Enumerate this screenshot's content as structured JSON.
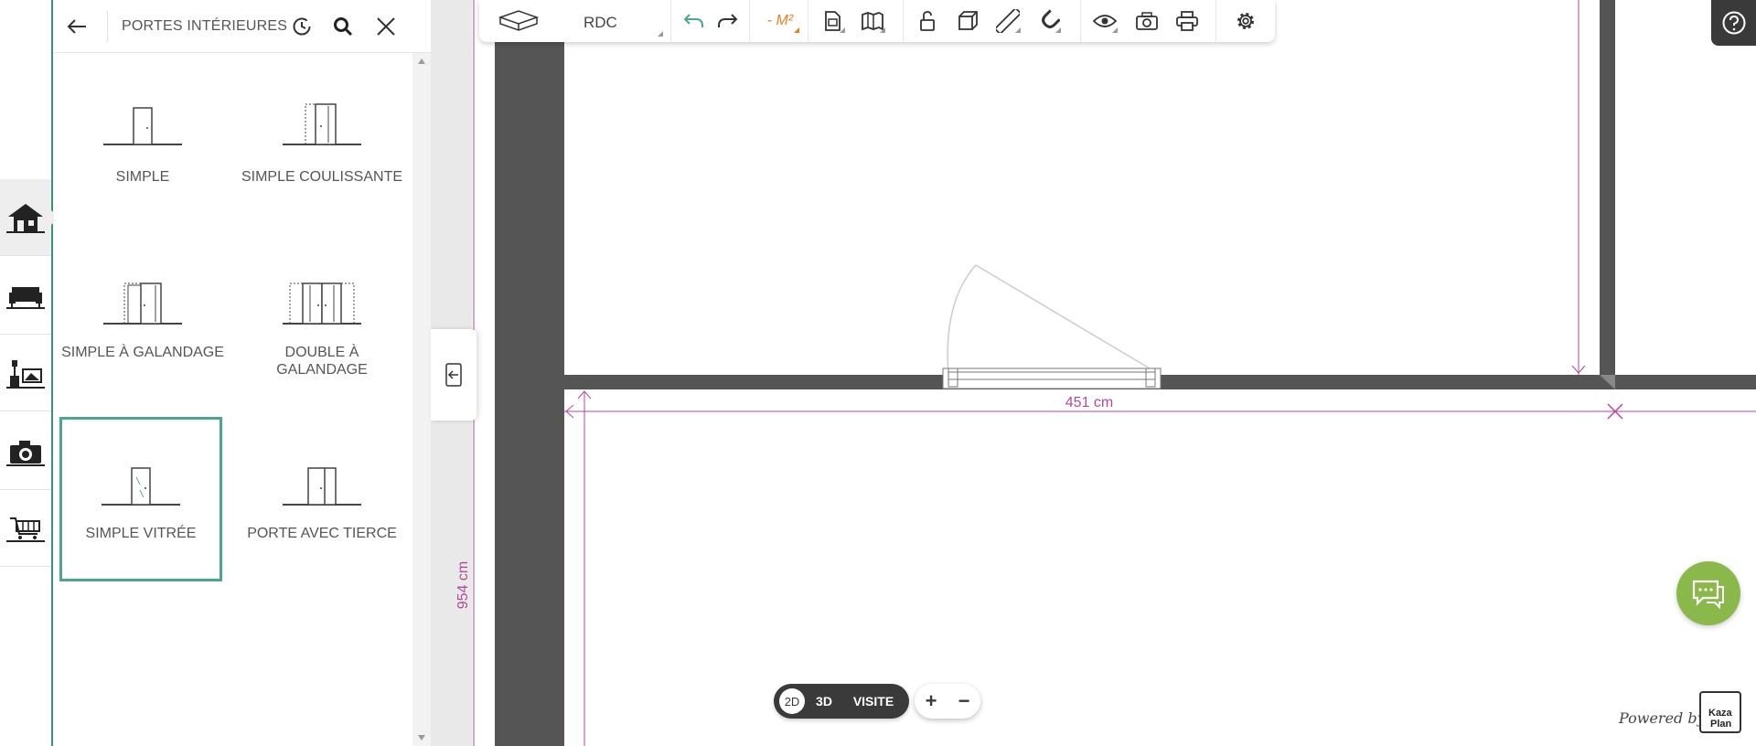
{
  "panel": {
    "title": "PORTES INTÉRIEURES",
    "items": [
      {
        "label": "SIMPLE",
        "icon": "simple-door-icon",
        "selected": false
      },
      {
        "label": "SIMPLE COULISSANTE",
        "icon": "sliding-door-icon",
        "selected": false
      },
      {
        "label": "SIMPLE À GALANDAGE",
        "icon": "pocket-door-icon",
        "selected": false
      },
      {
        "label": "DOUBLE À GALANDAGE",
        "icon": "double-pocket-door-icon",
        "selected": false
      },
      {
        "label": "SIMPLE VITRÉE",
        "icon": "glazed-door-icon",
        "selected": true
      },
      {
        "label": "PORTE AVEC TIERCE",
        "icon": "door-with-sidelight-icon",
        "selected": false
      }
    ]
  },
  "rail": {
    "items": [
      {
        "icon": "house-icon",
        "active": true
      },
      {
        "icon": "sofa-icon",
        "active": false
      },
      {
        "icon": "decoration-icon",
        "active": false
      },
      {
        "icon": "camera-icon",
        "active": false
      },
      {
        "icon": "shopping-cart-icon",
        "active": false
      }
    ]
  },
  "toolbar": {
    "floor_label": "RDC",
    "area_label": "- M²",
    "icons": [
      "floor-3d-icon",
      "undo-icon",
      "redo-icon",
      "area-icon",
      "document-icon",
      "map-icon",
      "lock-icon",
      "cube-icon",
      "ruler-icon",
      "magnet-icon",
      "eye-icon",
      "camera-icon",
      "printer-icon",
      "settings-icon"
    ]
  },
  "plan": {
    "dimension_horizontal": "451 cm",
    "dimension_vertical": "954 cm"
  },
  "view_toggle": {
    "mode_2d": "2D",
    "mode_3d": "3D",
    "mode_visit": "VISITE",
    "active": "2D"
  },
  "zoom": {
    "in_label": "+",
    "out_label": "−"
  },
  "branding": {
    "powered_by": "Powered by",
    "logo_line1": "Kaza",
    "logo_line2": "Plan"
  },
  "colors": {
    "accent_green": "#4aa68f",
    "chat_green": "#8bb84a",
    "dimension_magenta": "#b24a9c",
    "wall_gray": "#555555",
    "area_orange": "#e67e22"
  }
}
